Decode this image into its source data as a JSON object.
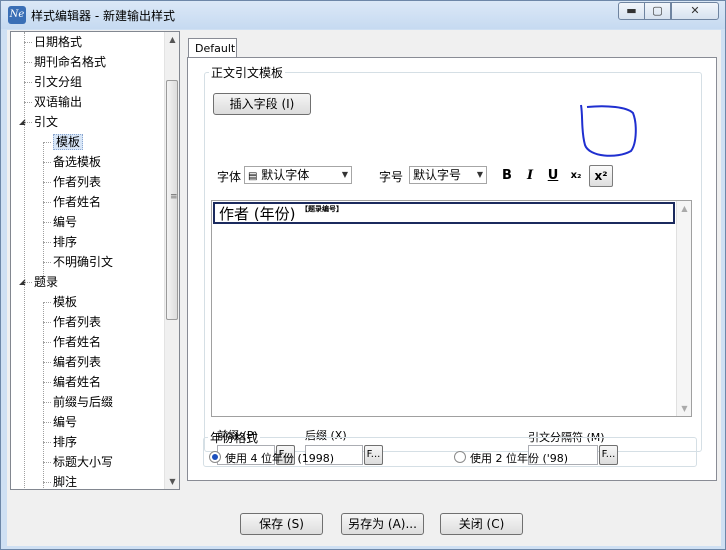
{
  "window": {
    "title": "样式编辑器 - 新建输出样式",
    "app_icon": "Ne"
  },
  "tree": {
    "items": [
      {
        "label": "日期格式",
        "level": 0
      },
      {
        "label": "期刊命名格式",
        "level": 0
      },
      {
        "label": "引文分组",
        "level": 0
      },
      {
        "label": "双语输出",
        "level": 0
      },
      {
        "label": "引文",
        "level": 0,
        "expanded": true
      },
      {
        "label": "模板",
        "level": 1,
        "selected": true
      },
      {
        "label": "备选模板",
        "level": 1
      },
      {
        "label": "作者列表",
        "level": 1
      },
      {
        "label": "作者姓名",
        "level": 1
      },
      {
        "label": "编号",
        "level": 1
      },
      {
        "label": "排序",
        "level": 1
      },
      {
        "label": "不明确引文",
        "level": 1
      },
      {
        "label": "题录",
        "level": 0,
        "expanded": true
      },
      {
        "label": "模板",
        "level": 1
      },
      {
        "label": "作者列表",
        "level": 1
      },
      {
        "label": "作者姓名",
        "level": 1
      },
      {
        "label": "编者列表",
        "level": 1
      },
      {
        "label": "编者姓名",
        "level": 1
      },
      {
        "label": "前缀与后缀",
        "level": 1
      },
      {
        "label": "编号",
        "level": 1
      },
      {
        "label": "排序",
        "level": 1
      },
      {
        "label": "标题大小写",
        "level": 1
      },
      {
        "label": "脚注",
        "level": 1
      }
    ]
  },
  "tab": {
    "label": "Default"
  },
  "template_group": {
    "legend": "正文引文模板",
    "insert_field_label": "插入字段 (I)",
    "font_label": "字体",
    "font_value": "默认字体",
    "size_label": "字号",
    "size_value": "默认字号",
    "bold": "B",
    "italic": "I",
    "underline": "U",
    "subscript": "x₂",
    "superscript": "x²",
    "editor_text": "作者 (年份)",
    "editor_field": "【题录编号】",
    "prefix_label": "前缀 (P)",
    "suffix_label": "后缀 (X)",
    "separator_label": "引文分隔符 (M)",
    "ellipsis": "F..."
  },
  "year_group": {
    "legend": "年份格式",
    "option_4": "使用 4 位年份 (1998)",
    "option_2": "使用 2 位年份 ('98)",
    "selected": "option_4"
  },
  "buttons": {
    "save": "保存 (S)",
    "save_as": "另存为 (A)...",
    "close": "关闭 (C)"
  },
  "annotation_color": "#1f2fd0"
}
